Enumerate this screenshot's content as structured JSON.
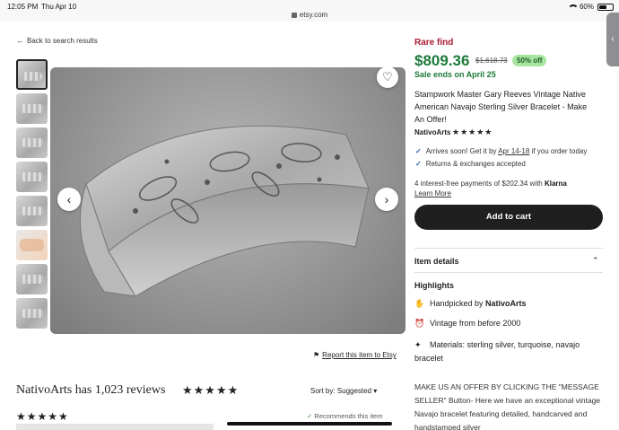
{
  "status": {
    "time": "12:05 PM",
    "date": "Thu Apr 10",
    "url": "etsy.com",
    "battery": "60%",
    "battery_level": 0.6
  },
  "nav": {
    "back_label": "Back to search results"
  },
  "listing": {
    "rare_label": "Rare find",
    "price": "$809.36",
    "original_price": "$1,618.73",
    "discount_badge": "50% off",
    "sale_ends": "Sale ends on April 25",
    "title": "Stampwork Master Gary Reeves Vintage Native American Navajo Sterling Silver Bracelet - Make An Offer!",
    "shop_name": "NativoArts",
    "shop_stars": "★★★★★",
    "shipping_prefix": "Arrives soon! Get it by ",
    "shipping_date": "Apr 14-18",
    "shipping_suffix": " if you order today",
    "returns": "Returns & exchanges accepted",
    "klarna_text": "4 interest-free payments of $202.34 with ",
    "klarna_brand": "Klarna",
    "learn_more": "Learn More",
    "add_to_cart": "Add to cart",
    "item_details": "Item details",
    "highlights_title": "Highlights",
    "handpicked_prefix": "Handpicked by ",
    "handpicked_shop": "NativoArts",
    "vintage": "Vintage from before 2000",
    "materials": "Materials: sterling silver, turquoise, navajo bracelet",
    "description": "MAKE US AN OFFER BY CLICKING THE \"MESSAGE SELLER\" Button- Here we have an exceptional vintage Navajo bracelet featuring detailed, handcarved and handstamped silver"
  },
  "report": {
    "label": "Report this item to Etsy"
  },
  "reviews": {
    "title": "NativoArts has 1,023 reviews",
    "stars": "★★★★★",
    "sort_label": "Sort by: Suggested",
    "first_stars": "★★★★★",
    "recommends": "Recommends this item"
  }
}
